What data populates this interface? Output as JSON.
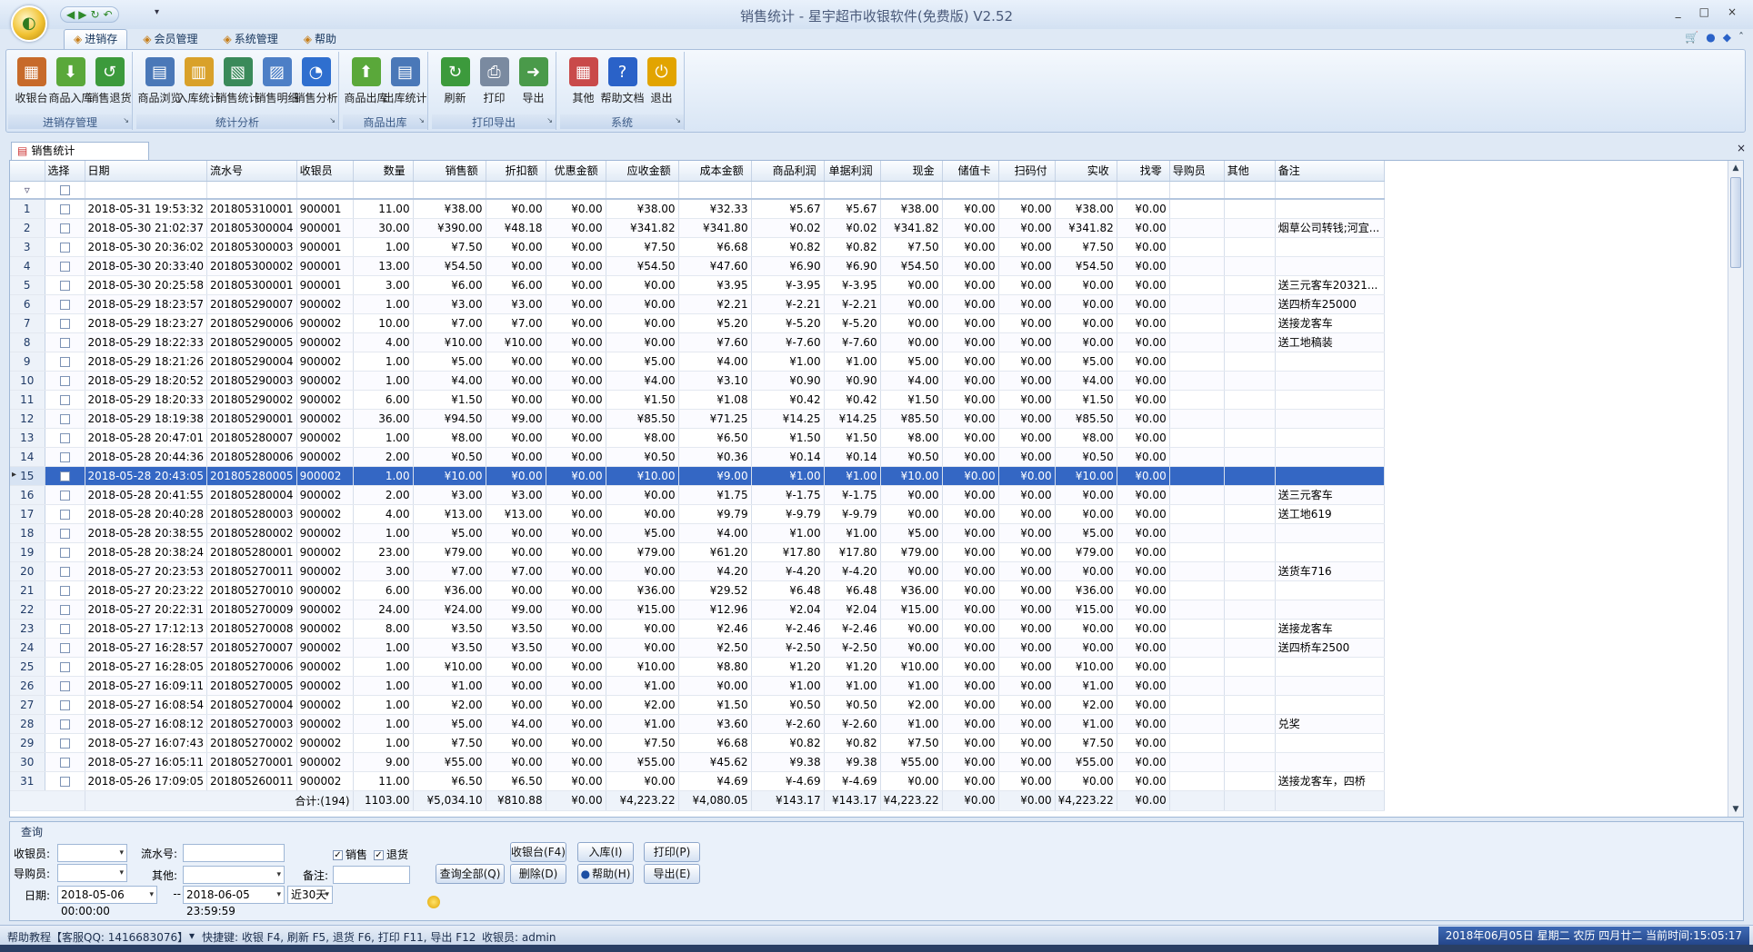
{
  "window": {
    "title": "销售统计 - 星宇超市收银软件(免费版) V2.52",
    "minimize": "_",
    "maximize": "□",
    "close": "×"
  },
  "ribbon_tabs": [
    {
      "label": "进销存",
      "active": true
    },
    {
      "label": "会员管理"
    },
    {
      "label": "系统管理"
    },
    {
      "label": "帮助"
    }
  ],
  "ribbon_groups": [
    {
      "name": "进销存管理",
      "buttons": [
        {
          "label": "收银台",
          "icon": "cash-register-icon",
          "color": "#c76a2a"
        },
        {
          "label": "商品入库",
          "icon": "stock-in-icon",
          "color": "#5aa83a"
        },
        {
          "label": "销售退货",
          "icon": "return-icon",
          "color": "#3c9a3c"
        }
      ]
    },
    {
      "name": "统计分析",
      "buttons": [
        {
          "label": "商品浏览",
          "icon": "browse-icon",
          "color": "#4a78b8"
        },
        {
          "label": "入库统计",
          "icon": "stock-stats-icon",
          "color": "#d9a12a"
        },
        {
          "label": "销售统计",
          "icon": "sales-stats-icon",
          "color": "#3a8a5a"
        },
        {
          "label": "销售明细",
          "icon": "sales-detail-icon",
          "color": "#4d7fc6"
        },
        {
          "label": "销售分析",
          "icon": "pie-chart-icon",
          "color": "#2f6fcf"
        }
      ]
    },
    {
      "name": "商品出库",
      "buttons": [
        {
          "label": "商品出库",
          "icon": "stock-out-icon",
          "color": "#5aa83a"
        },
        {
          "label": "出库统计",
          "icon": "out-stats-icon",
          "color": "#4a78b8"
        }
      ]
    },
    {
      "name": "打印导出",
      "buttons": [
        {
          "label": "刷新",
          "icon": "refresh-icon",
          "color": "#3c9a3c"
        },
        {
          "label": "打印",
          "icon": "printer-icon",
          "color": "#7a8aa0"
        },
        {
          "label": "导出",
          "icon": "export-icon",
          "color": "#4a9a4a"
        }
      ]
    },
    {
      "name": "系统",
      "buttons": [
        {
          "label": "其他",
          "icon": "grid-icon",
          "color": "#c94a4a"
        },
        {
          "label": "帮助文档",
          "icon": "help-icon",
          "color": "#2a62c8"
        },
        {
          "label": "退出",
          "icon": "power-icon",
          "color": "#e2a400"
        }
      ]
    }
  ],
  "doc_tab": "销售统计",
  "grid": {
    "columns": [
      "选择",
      "日期",
      "流水号",
      "收银员",
      "数量",
      "销售额",
      "折扣额",
      "优惠金额",
      "应收金额",
      "成本金额",
      "商品利润",
      "单据利润",
      "现金",
      "储值卡",
      "扫码付",
      "实收",
      "找零",
      "导购员",
      "其他",
      "备注"
    ],
    "rows": [
      [
        "1",
        "2018-05-31 19:53:32",
        "201805310001",
        "900001",
        "11.00",
        "¥38.00",
        "¥0.00",
        "¥0.00",
        "¥38.00",
        "¥32.33",
        "¥5.67",
        "¥5.67",
        "¥38.00",
        "¥0.00",
        "¥0.00",
        "¥38.00",
        "¥0.00",
        "",
        "",
        ""
      ],
      [
        "2",
        "2018-05-30 21:02:37",
        "201805300004",
        "900001",
        "30.00",
        "¥390.00",
        "¥48.18",
        "¥0.00",
        "¥341.82",
        "¥341.80",
        "¥0.02",
        "¥0.02",
        "¥341.82",
        "¥0.00",
        "¥0.00",
        "¥341.82",
        "¥0.00",
        "",
        "",
        "烟草公司转钱;河宜..."
      ],
      [
        "3",
        "2018-05-30 20:36:02",
        "201805300003",
        "900001",
        "1.00",
        "¥7.50",
        "¥0.00",
        "¥0.00",
        "¥7.50",
        "¥6.68",
        "¥0.82",
        "¥0.82",
        "¥7.50",
        "¥0.00",
        "¥0.00",
        "¥7.50",
        "¥0.00",
        "",
        "",
        ""
      ],
      [
        "4",
        "2018-05-30 20:33:40",
        "201805300002",
        "900001",
        "13.00",
        "¥54.50",
        "¥0.00",
        "¥0.00",
        "¥54.50",
        "¥47.60",
        "¥6.90",
        "¥6.90",
        "¥54.50",
        "¥0.00",
        "¥0.00",
        "¥54.50",
        "¥0.00",
        "",
        "",
        ""
      ],
      [
        "5",
        "2018-05-30 20:25:58",
        "201805300001",
        "900001",
        "3.00",
        "¥6.00",
        "¥6.00",
        "¥0.00",
        "¥0.00",
        "¥3.95",
        "¥-3.95",
        "¥-3.95",
        "¥0.00",
        "¥0.00",
        "¥0.00",
        "¥0.00",
        "¥0.00",
        "",
        "",
        "送三元客车20321..."
      ],
      [
        "6",
        "2018-05-29 18:23:57",
        "201805290007",
        "900002",
        "1.00",
        "¥3.00",
        "¥3.00",
        "¥0.00",
        "¥0.00",
        "¥2.21",
        "¥-2.21",
        "¥-2.21",
        "¥0.00",
        "¥0.00",
        "¥0.00",
        "¥0.00",
        "¥0.00",
        "",
        "",
        "送四桥车25000"
      ],
      [
        "7",
        "2018-05-29 18:23:27",
        "201805290006",
        "900002",
        "10.00",
        "¥7.00",
        "¥7.00",
        "¥0.00",
        "¥0.00",
        "¥5.20",
        "¥-5.20",
        "¥-5.20",
        "¥0.00",
        "¥0.00",
        "¥0.00",
        "¥0.00",
        "¥0.00",
        "",
        "",
        "送接龙客车"
      ],
      [
        "8",
        "2018-05-29 18:22:33",
        "201805290005",
        "900002",
        "4.00",
        "¥10.00",
        "¥10.00",
        "¥0.00",
        "¥0.00",
        "¥7.60",
        "¥-7.60",
        "¥-7.60",
        "¥0.00",
        "¥0.00",
        "¥0.00",
        "¥0.00",
        "¥0.00",
        "",
        "",
        "送工地稿装"
      ],
      [
        "9",
        "2018-05-29 18:21:26",
        "201805290004",
        "900002",
        "1.00",
        "¥5.00",
        "¥0.00",
        "¥0.00",
        "¥5.00",
        "¥4.00",
        "¥1.00",
        "¥1.00",
        "¥5.00",
        "¥0.00",
        "¥0.00",
        "¥5.00",
        "¥0.00",
        "",
        "",
        ""
      ],
      [
        "10",
        "2018-05-29 18:20:52",
        "201805290003",
        "900002",
        "1.00",
        "¥4.00",
        "¥0.00",
        "¥0.00",
        "¥4.00",
        "¥3.10",
        "¥0.90",
        "¥0.90",
        "¥4.00",
        "¥0.00",
        "¥0.00",
        "¥4.00",
        "¥0.00",
        "",
        "",
        ""
      ],
      [
        "11",
        "2018-05-29 18:20:33",
        "201805290002",
        "900002",
        "6.00",
        "¥1.50",
        "¥0.00",
        "¥0.00",
        "¥1.50",
        "¥1.08",
        "¥0.42",
        "¥0.42",
        "¥1.50",
        "¥0.00",
        "¥0.00",
        "¥1.50",
        "¥0.00",
        "",
        "",
        ""
      ],
      [
        "12",
        "2018-05-29 18:19:38",
        "201805290001",
        "900002",
        "36.00",
        "¥94.50",
        "¥9.00",
        "¥0.00",
        "¥85.50",
        "¥71.25",
        "¥14.25",
        "¥14.25",
        "¥85.50",
        "¥0.00",
        "¥0.00",
        "¥85.50",
        "¥0.00",
        "",
        "",
        ""
      ],
      [
        "13",
        "2018-05-28 20:47:01",
        "201805280007",
        "900002",
        "1.00",
        "¥8.00",
        "¥0.00",
        "¥0.00",
        "¥8.00",
        "¥6.50",
        "¥1.50",
        "¥1.50",
        "¥8.00",
        "¥0.00",
        "¥0.00",
        "¥8.00",
        "¥0.00",
        "",
        "",
        ""
      ],
      [
        "14",
        "2018-05-28 20:44:36",
        "201805280006",
        "900002",
        "2.00",
        "¥0.50",
        "¥0.00",
        "¥0.00",
        "¥0.50",
        "¥0.36",
        "¥0.14",
        "¥0.14",
        "¥0.50",
        "¥0.00",
        "¥0.00",
        "¥0.50",
        "¥0.00",
        "",
        "",
        ""
      ],
      [
        "15",
        "2018-05-28 20:43:05",
        "201805280005",
        "900002",
        "1.00",
        "¥10.00",
        "¥0.00",
        "¥0.00",
        "¥10.00",
        "¥9.00",
        "¥1.00",
        "¥1.00",
        "¥10.00",
        "¥0.00",
        "¥0.00",
        "¥10.00",
        "¥0.00",
        "",
        "",
        ""
      ],
      [
        "16",
        "2018-05-28 20:41:55",
        "201805280004",
        "900002",
        "2.00",
        "¥3.00",
        "¥3.00",
        "¥0.00",
        "¥0.00",
        "¥1.75",
        "¥-1.75",
        "¥-1.75",
        "¥0.00",
        "¥0.00",
        "¥0.00",
        "¥0.00",
        "¥0.00",
        "",
        "",
        "送三元客车"
      ],
      [
        "17",
        "2018-05-28 20:40:28",
        "201805280003",
        "900002",
        "4.00",
        "¥13.00",
        "¥13.00",
        "¥0.00",
        "¥0.00",
        "¥9.79",
        "¥-9.79",
        "¥-9.79",
        "¥0.00",
        "¥0.00",
        "¥0.00",
        "¥0.00",
        "¥0.00",
        "",
        "",
        "送工地619"
      ],
      [
        "18",
        "2018-05-28 20:38:55",
        "201805280002",
        "900002",
        "1.00",
        "¥5.00",
        "¥0.00",
        "¥0.00",
        "¥5.00",
        "¥4.00",
        "¥1.00",
        "¥1.00",
        "¥5.00",
        "¥0.00",
        "¥0.00",
        "¥5.00",
        "¥0.00",
        "",
        "",
        ""
      ],
      [
        "19",
        "2018-05-28 20:38:24",
        "201805280001",
        "900002",
        "23.00",
        "¥79.00",
        "¥0.00",
        "¥0.00",
        "¥79.00",
        "¥61.20",
        "¥17.80",
        "¥17.80",
        "¥79.00",
        "¥0.00",
        "¥0.00",
        "¥79.00",
        "¥0.00",
        "",
        "",
        ""
      ],
      [
        "20",
        "2018-05-27 20:23:53",
        "201805270011",
        "900002",
        "3.00",
        "¥7.00",
        "¥7.00",
        "¥0.00",
        "¥0.00",
        "¥4.20",
        "¥-4.20",
        "¥-4.20",
        "¥0.00",
        "¥0.00",
        "¥0.00",
        "¥0.00",
        "¥0.00",
        "",
        "",
        "送货车716"
      ],
      [
        "21",
        "2018-05-27 20:23:22",
        "201805270010",
        "900002",
        "6.00",
        "¥36.00",
        "¥0.00",
        "¥0.00",
        "¥36.00",
        "¥29.52",
        "¥6.48",
        "¥6.48",
        "¥36.00",
        "¥0.00",
        "¥0.00",
        "¥36.00",
        "¥0.00",
        "",
        "",
        ""
      ],
      [
        "22",
        "2018-05-27 20:22:31",
        "201805270009",
        "900002",
        "24.00",
        "¥24.00",
        "¥9.00",
        "¥0.00",
        "¥15.00",
        "¥12.96",
        "¥2.04",
        "¥2.04",
        "¥15.00",
        "¥0.00",
        "¥0.00",
        "¥15.00",
        "¥0.00",
        "",
        "",
        ""
      ],
      [
        "23",
        "2018-05-27 17:12:13",
        "201805270008",
        "900002",
        "8.00",
        "¥3.50",
        "¥3.50",
        "¥0.00",
        "¥0.00",
        "¥2.46",
        "¥-2.46",
        "¥-2.46",
        "¥0.00",
        "¥0.00",
        "¥0.00",
        "¥0.00",
        "¥0.00",
        "",
        "",
        "送接龙客车"
      ],
      [
        "24",
        "2018-05-27 16:28:57",
        "201805270007",
        "900002",
        "1.00",
        "¥3.50",
        "¥3.50",
        "¥0.00",
        "¥0.00",
        "¥2.50",
        "¥-2.50",
        "¥-2.50",
        "¥0.00",
        "¥0.00",
        "¥0.00",
        "¥0.00",
        "¥0.00",
        "",
        "",
        "送四桥车2500"
      ],
      [
        "25",
        "2018-05-27 16:28:05",
        "201805270006",
        "900002",
        "1.00",
        "¥10.00",
        "¥0.00",
        "¥0.00",
        "¥10.00",
        "¥8.80",
        "¥1.20",
        "¥1.20",
        "¥10.00",
        "¥0.00",
        "¥0.00",
        "¥10.00",
        "¥0.00",
        "",
        "",
        ""
      ],
      [
        "26",
        "2018-05-27 16:09:11",
        "201805270005",
        "900002",
        "1.00",
        "¥1.00",
        "¥0.00",
        "¥0.00",
        "¥1.00",
        "¥0.00",
        "¥1.00",
        "¥1.00",
        "¥1.00",
        "¥0.00",
        "¥0.00",
        "¥1.00",
        "¥0.00",
        "",
        "",
        ""
      ],
      [
        "27",
        "2018-05-27 16:08:54",
        "201805270004",
        "900002",
        "1.00",
        "¥2.00",
        "¥0.00",
        "¥0.00",
        "¥2.00",
        "¥1.50",
        "¥0.50",
        "¥0.50",
        "¥2.00",
        "¥0.00",
        "¥0.00",
        "¥2.00",
        "¥0.00",
        "",
        "",
        ""
      ],
      [
        "28",
        "2018-05-27 16:08:12",
        "201805270003",
        "900002",
        "1.00",
        "¥5.00",
        "¥4.00",
        "¥0.00",
        "¥1.00",
        "¥3.60",
        "¥-2.60",
        "¥-2.60",
        "¥1.00",
        "¥0.00",
        "¥0.00",
        "¥1.00",
        "¥0.00",
        "",
        "",
        "兑奖"
      ],
      [
        "29",
        "2018-05-27 16:07:43",
        "201805270002",
        "900002",
        "1.00",
        "¥7.50",
        "¥0.00",
        "¥0.00",
        "¥7.50",
        "¥6.68",
        "¥0.82",
        "¥0.82",
        "¥7.50",
        "¥0.00",
        "¥0.00",
        "¥7.50",
        "¥0.00",
        "",
        "",
        ""
      ],
      [
        "30",
        "2018-05-27 16:05:11",
        "201805270001",
        "900002",
        "9.00",
        "¥55.00",
        "¥0.00",
        "¥0.00",
        "¥55.00",
        "¥45.62",
        "¥9.38",
        "¥9.38",
        "¥55.00",
        "¥0.00",
        "¥0.00",
        "¥55.00",
        "¥0.00",
        "",
        "",
        ""
      ],
      [
        "31",
        "2018-05-26 17:09:05",
        "201805260011",
        "900002",
        "11.00",
        "¥6.50",
        "¥6.50",
        "¥0.00",
        "¥0.00",
        "¥4.69",
        "¥-4.69",
        "¥-4.69",
        "¥0.00",
        "¥0.00",
        "¥0.00",
        "¥0.00",
        "¥0.00",
        "",
        "",
        "送接龙客车，四桥"
      ]
    ],
    "selected_row": 15,
    "totals": {
      "label": "合计:(194)",
      "数量": "1103.00",
      "销售额": "¥5,034.10",
      "折扣额": "¥810.88",
      "优惠金额": "¥0.00",
      "应收金额": "¥4,223.22",
      "成本金额": "¥4,080.05",
      "商品利润": "¥143.17",
      "单据利润": "¥143.17",
      "现金": "¥4,223.22",
      "储值卡": "¥0.00",
      "扫码付": "¥0.00",
      "实收": "¥4,223.22",
      "找零": "¥0.00"
    }
  },
  "query": {
    "title": "查询",
    "cashier_label": "收银员:",
    "cashier_value": "",
    "serial_label": "流水号:",
    "serial_value": "",
    "sales_label": "销售",
    "returns_label": "退货",
    "guide_label": "导购员:",
    "guide_value": "",
    "other_label": "其他:",
    "other_value": "",
    "note_label": "备注:",
    "note_value": "",
    "date_label": "日期:",
    "date_from": "2018-05-06 00:00:00",
    "date_sep": "-- ",
    "date_to": "2018-06-05 23:59:59",
    "range": "近30天",
    "btn_register": "收银台(F4)",
    "btn_stockin": "入库(I)",
    "btn_print": "打印(P)",
    "btn_queryall": "查询全部(Q)",
    "btn_delete": "删除(D)",
    "btn_help": "帮助(H)",
    "btn_export": "导出(E)"
  },
  "status": {
    "help": "帮助教程【客服QQ: 1416683076】",
    "shortcuts": "快捷键: 收银 F4, 刷新 F5, 退货 F6, 打印 F11, 导出 F12",
    "user": "收银员: admin",
    "datetime": "2018年06月05日 星期二 农历 四月廿二 当前时间:15:05:17"
  },
  "colors": {
    "accent": "#3467c4",
    "ribbon_border": "#a9bfdc"
  }
}
